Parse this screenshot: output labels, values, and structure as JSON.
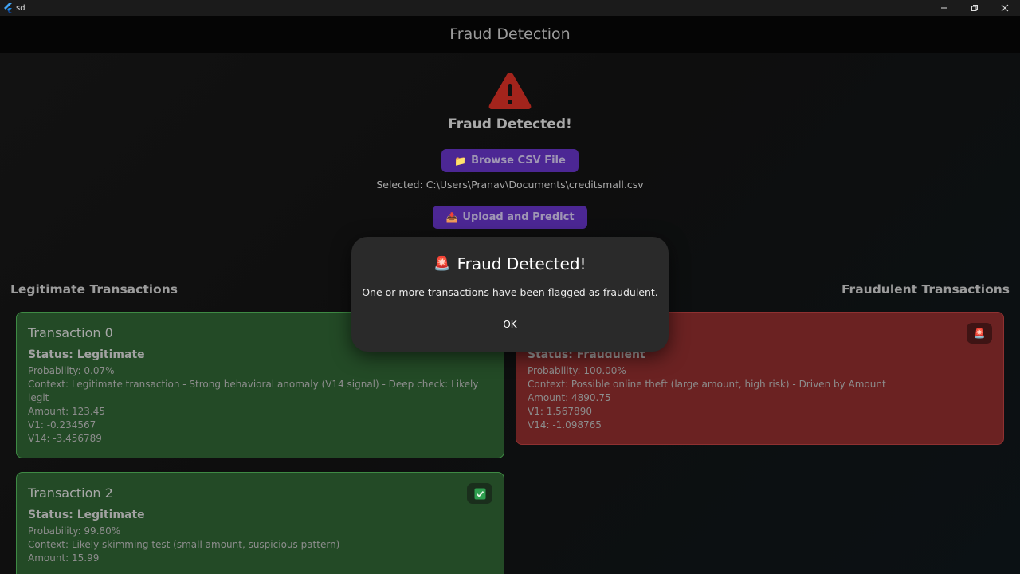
{
  "window": {
    "title": "sd"
  },
  "appbar": {
    "title": "Fraud Detection"
  },
  "status": {
    "icon": "warning-icon",
    "title": "Fraud Detected!"
  },
  "actions": {
    "browse_label": "Browse CSV File",
    "browse_icon": "folder-icon",
    "selected_text": "Selected: C:\\Users\\Pranav\\Documents\\creditsmall.csv",
    "upload_label": "Upload and Predict",
    "upload_icon": "inbox-tray-icon"
  },
  "sections": {
    "legitimate_title": "Legitimate Transactions",
    "fraudulent_title": "Fraudulent Transactions"
  },
  "legitimate": [
    {
      "title": "Transaction 0",
      "status": "Status: Legitimate",
      "probability": "Probability: 0.07%",
      "context": "Context: Legitimate transaction - Strong behavioral anomaly (V14 signal) - Deep check: Likely legit",
      "amount": "Amount: 123.45",
      "v1": "V1: -0.234567",
      "v14": "V14: -3.456789"
    },
    {
      "title": "Transaction 2",
      "status": "Status: Legitimate",
      "probability": "Probability: 99.80%",
      "context": "Context: Likely skimming test (small amount, suspicious pattern)",
      "amount": "Amount: 15.99",
      "badge_icon": "check-icon"
    }
  ],
  "fraudulent": [
    {
      "status": "Status: Fraudulent",
      "probability": "Probability: 100.00%",
      "context": "Context: Possible online theft (large amount, high risk) - Driven by Amount",
      "amount": "Amount: 4890.75",
      "v1": "V1: 1.567890",
      "v14": "V14: -1.098765",
      "badge_icon": "siren-icon"
    }
  ],
  "dialog": {
    "title": "Fraud Detected!",
    "title_icon": "siren-icon",
    "message": "One or more transactions have been flagged as fraudulent.",
    "ok_label": "OK"
  },
  "colors": {
    "legit_card": "#234a26",
    "fraud_card": "#6b2222",
    "button": "#4c2794",
    "warning": "#b3261e"
  }
}
